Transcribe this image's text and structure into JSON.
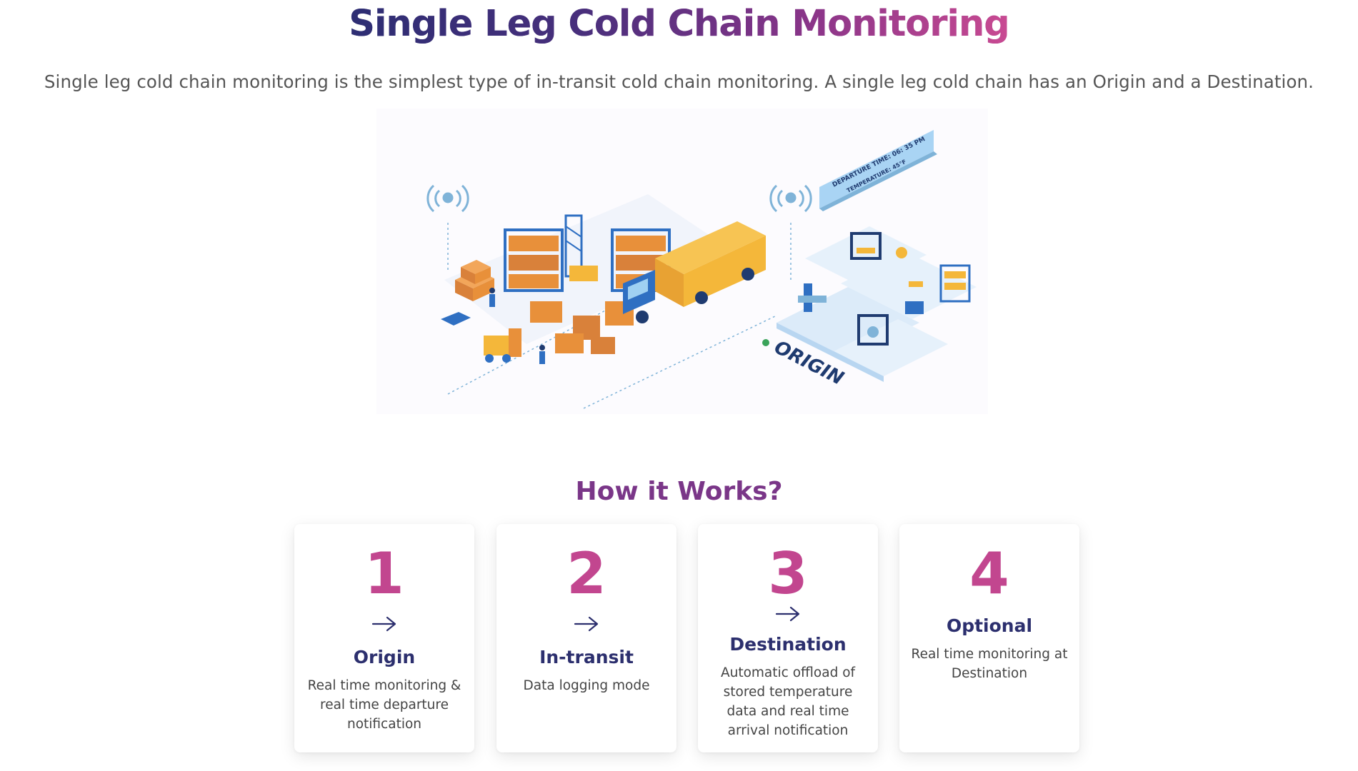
{
  "header": {
    "title": "Single Leg Cold Chain Monitoring",
    "subtitle": "Single leg cold chain monitoring is the simplest type of in-transit cold chain monitoring. A single leg cold chain has an Origin and a Destination."
  },
  "illustration": {
    "sign_line1": "DEPARTURE TIME: 06: 35 PM",
    "sign_line2": "TEMPERATURE: 45°F",
    "origin_label": "ORIGIN"
  },
  "how_it_works": {
    "title": "How it Works?",
    "steps": [
      {
        "number": "1",
        "label": "Origin",
        "description": "Real time monitoring & real time departure notification",
        "icon": "arrow-right-icon"
      },
      {
        "number": "2",
        "label": "In-transit",
        "description": "Data logging mode",
        "icon": "arrow-right-icon"
      },
      {
        "number": "3",
        "label": "Destination",
        "description": "Automatic offload of stored temperature data and real time arrival notification",
        "icon": "arrow-right-icon"
      },
      {
        "number": "4",
        "label": "Optional",
        "description": "Real time monitoring at Destination"
      }
    ]
  },
  "colors": {
    "title_gradient_start": "#2d2e73",
    "title_gradient_end": "#c94a92",
    "accent_pink": "#c2468f",
    "section_purple": "#7a3688",
    "label_navy": "#2c2f6e",
    "box_orange": "#e8903a",
    "truck_yellow": "#f4b73a",
    "blue": "#2f6fc2"
  }
}
